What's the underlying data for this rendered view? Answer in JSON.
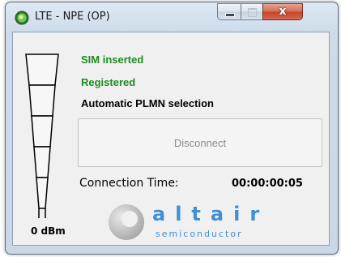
{
  "window": {
    "title": "LTE - NPE (OP)",
    "close_glyph": "x",
    "min_icon": "minimize-icon",
    "max_icon": "maximize-icon",
    "app_icon": "status-circle-icon"
  },
  "status": {
    "sim": "SIM inserted",
    "registration": "Registered",
    "plmn": "Automatic PLMN selection",
    "sim_color": "#1f8a1f",
    "registration_color": "#1f8a1f"
  },
  "signal": {
    "level_label": "0 dBm",
    "bars_total": 5,
    "bars_filled": 0
  },
  "actions": {
    "disconnect_label": "Disconnect",
    "disconnect_enabled": false
  },
  "connection": {
    "time_label": "Connection Time:",
    "time_value": "00:00:00:05"
  },
  "logo": {
    "word": "altair",
    "sub": "semiconductor",
    "color": "#3f8fd4",
    "accent": "#b7b7b7"
  }
}
